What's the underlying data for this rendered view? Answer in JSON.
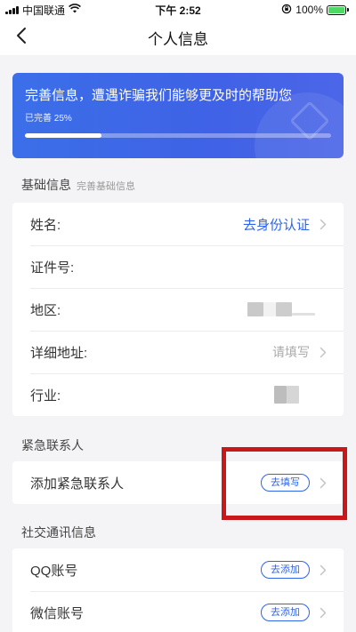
{
  "status_bar": {
    "carrier": "中国联通",
    "time": "下午 2:52",
    "battery": "100%",
    "icons": [
      "signal-icon",
      "wifi-icon",
      "rotation-lock-icon",
      "battery-charging-icon"
    ]
  },
  "nav": {
    "title": "个人信息",
    "back_icon": "chevron-left-icon"
  },
  "banner": {
    "title": "完善信息，遭遇诈骗我们能够更及时的帮助您",
    "progress_label": "已完善 25%",
    "progress_percent": 25,
    "accent": "#3f62e6"
  },
  "basic_info": {
    "title": "基础信息",
    "hint": "完善基础信息",
    "rows": [
      {
        "label": "姓名:",
        "value": "去身份认证"
      },
      {
        "label": "证件号:",
        "value": ""
      },
      {
        "label": "地区:",
        "value": ""
      },
      {
        "label": "详细地址:",
        "value": "请填写"
      },
      {
        "label": "行业:",
        "value": ""
      }
    ]
  },
  "emergency": {
    "title": "紧急联系人",
    "row_label": "添加紧急联系人",
    "action": "去填写"
  },
  "social": {
    "title": "社交通讯信息",
    "rows": [
      {
        "label": "QQ账号",
        "action": "去添加"
      },
      {
        "label": "微信账号",
        "action": "去添加"
      }
    ]
  },
  "colors": {
    "link": "#2f64e8",
    "highlight": "#c8181a",
    "background": "#f4f4f6"
  }
}
